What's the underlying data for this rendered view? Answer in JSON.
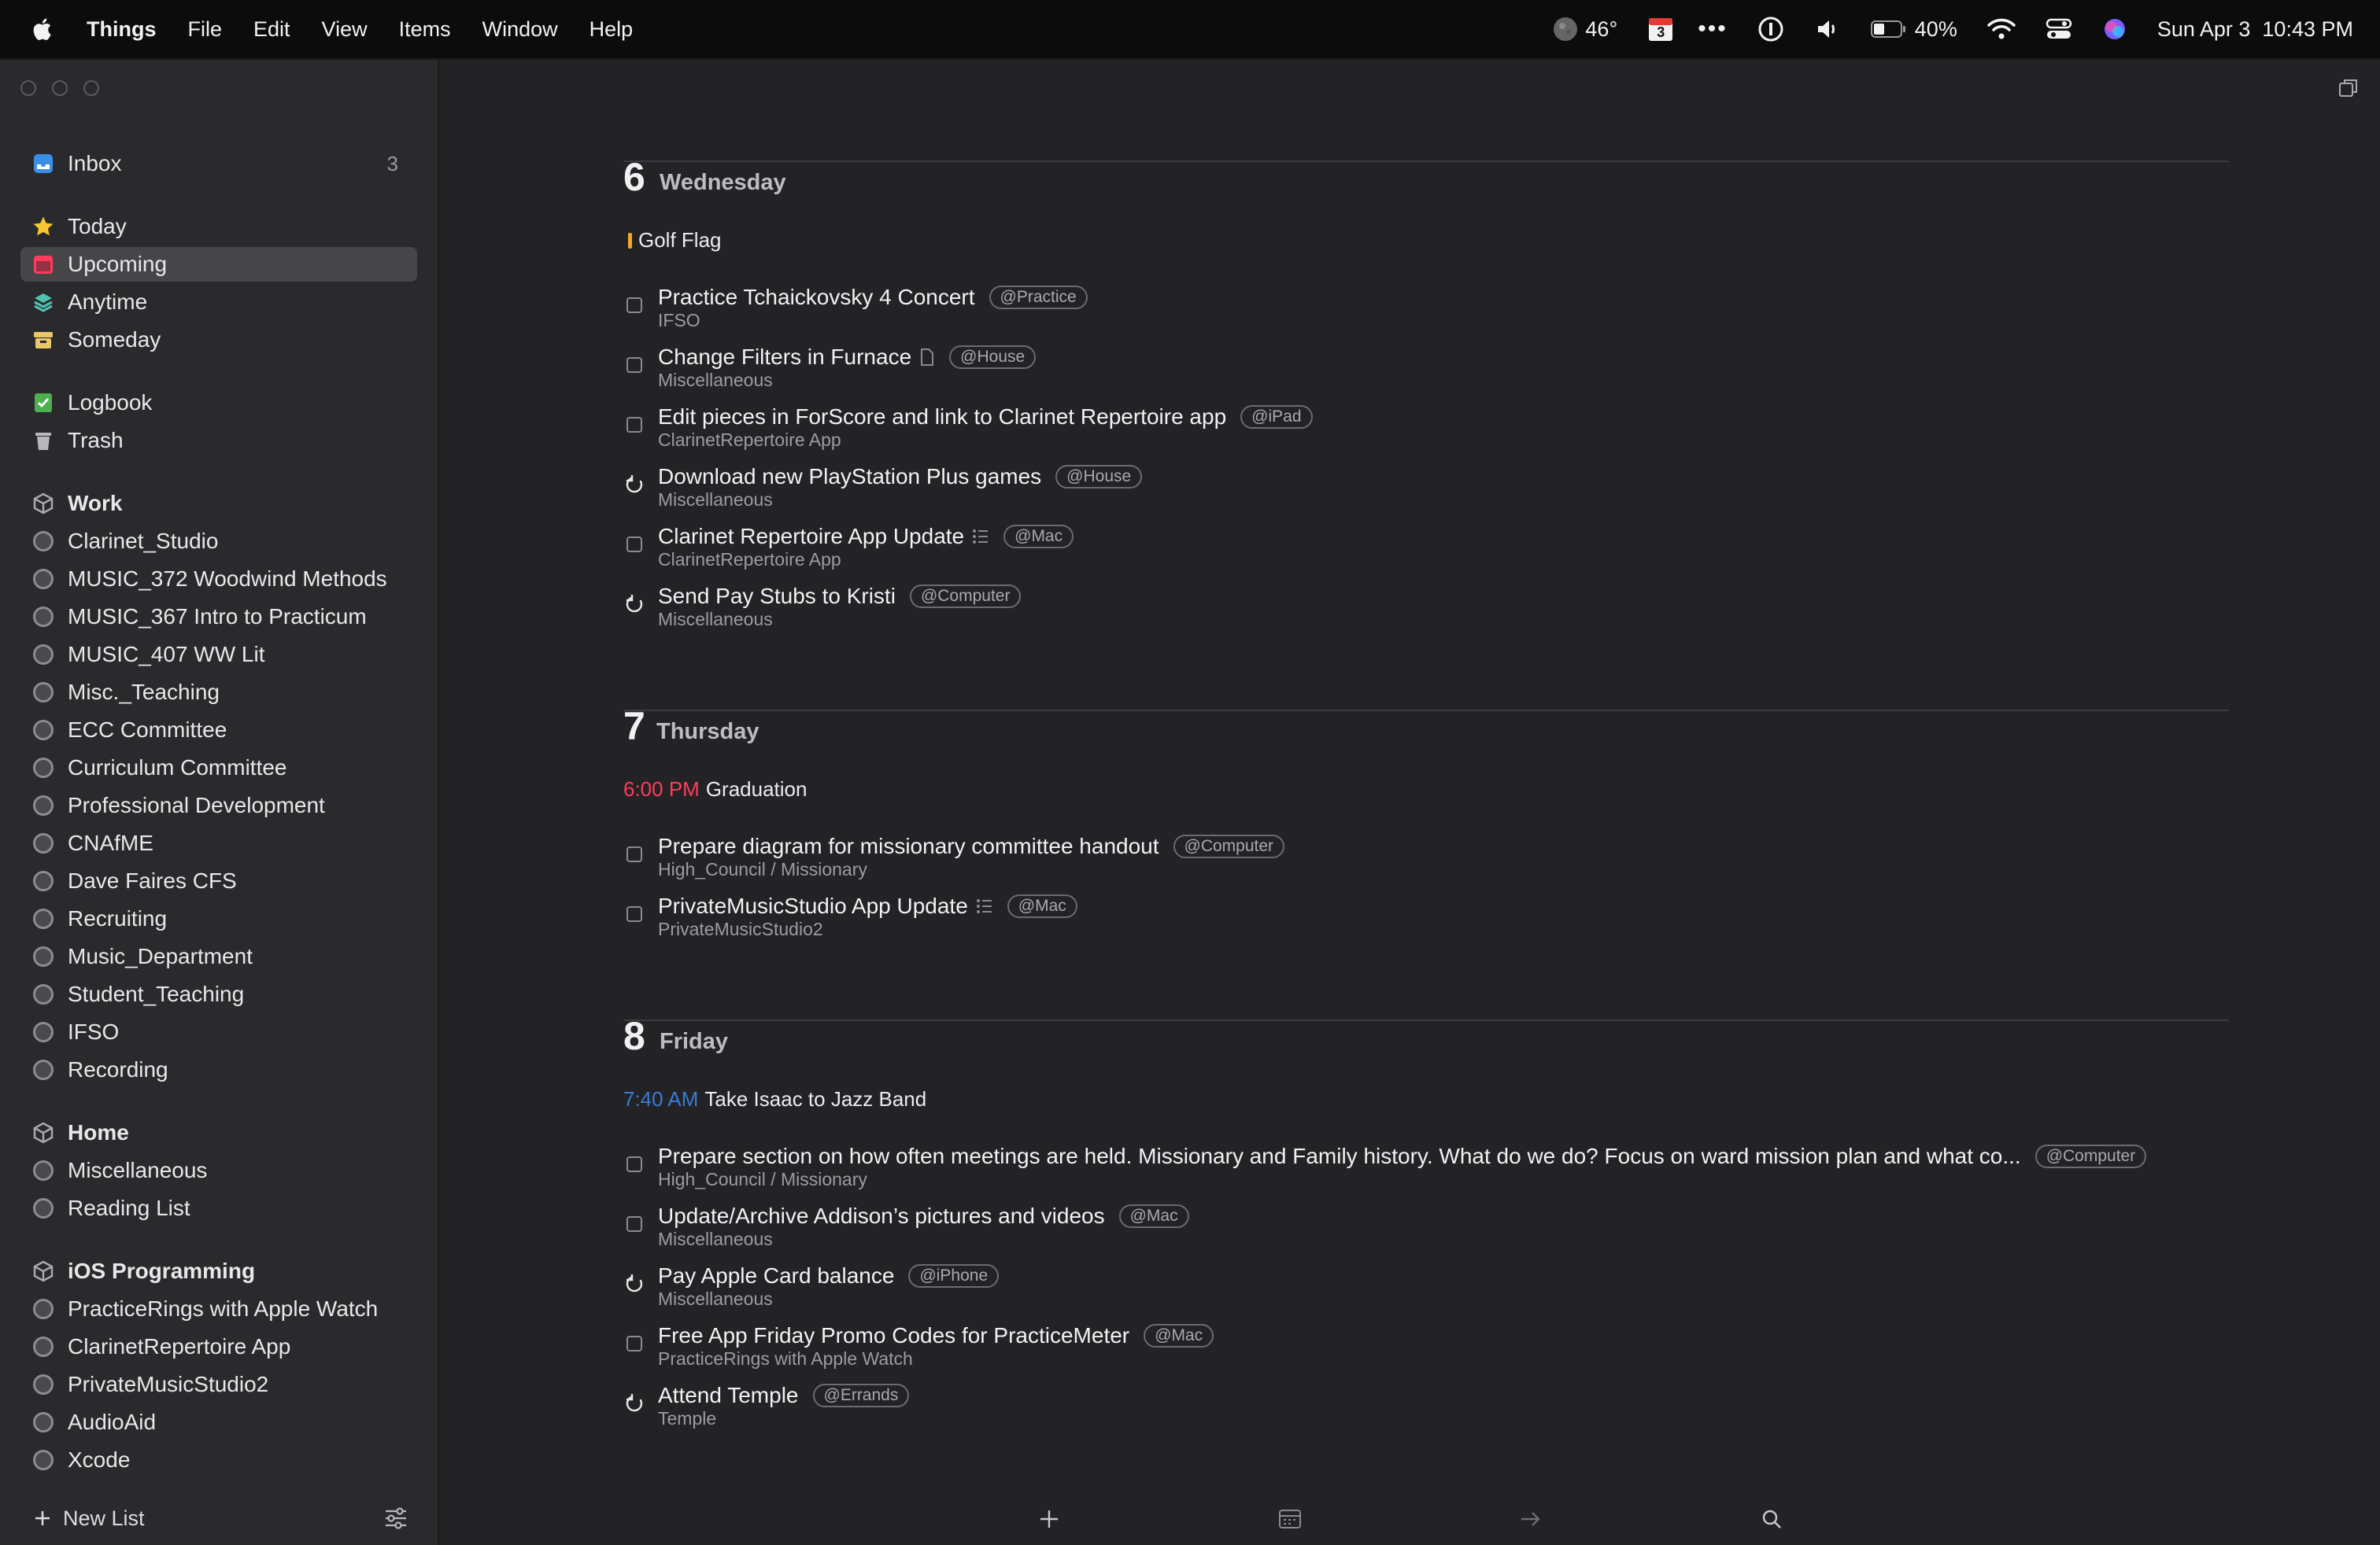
{
  "menubar": {
    "app_name": "Things",
    "menus": [
      "File",
      "Edit",
      "View",
      "Items",
      "Window",
      "Help"
    ],
    "weather": "46°",
    "calendar_day": "3",
    "battery": "40%",
    "datetime": "Sun Apr 3  10:43 PM"
  },
  "sidebar": {
    "inbox": {
      "label": "Inbox",
      "count": "3"
    },
    "today": "Today",
    "upcoming": "Upcoming",
    "anytime": "Anytime",
    "someday": "Someday",
    "logbook": "Logbook",
    "trash": "Trash",
    "areas": [
      {
        "name": "Work",
        "projects": [
          "Clarinet_Studio",
          "MUSIC_372 Woodwind Methods",
          "MUSIC_367 Intro to Practicum",
          "MUSIC_407 WW Lit",
          "Misc._Teaching",
          "ECC Committee",
          "Curriculum Committee",
          "Professional Development",
          "CNAfME",
          "Dave Faires CFS",
          "Recruiting",
          "Music_Department",
          "Student_Teaching",
          "IFSO",
          "Recording"
        ]
      },
      {
        "name": "Home",
        "projects": [
          "Miscellaneous",
          "Reading List"
        ]
      },
      {
        "name": "iOS Programming",
        "projects": [
          "PracticeRings with Apple Watch",
          "ClarinetRepertoire App",
          "PrivateMusicStudio2",
          "AudioAid",
          "Xcode"
        ]
      }
    ],
    "new_list": "New List"
  },
  "days": [
    {
      "number": "6",
      "name": "Wednesday",
      "event": {
        "time": "",
        "title": "Golf Flag"
      },
      "tasks": [
        {
          "title": "Practice Tchaickovsky 4 Concert",
          "tag": "@Practice",
          "project": "IFSO",
          "repeat": false,
          "note": false,
          "checklist": false
        },
        {
          "title": "Change Filters in Furnace",
          "tag": "@House",
          "project": "Miscellaneous",
          "repeat": false,
          "note": true,
          "checklist": false
        },
        {
          "title": "Edit pieces in ForScore and link to Clarinet Repertoire app",
          "tag": "@iPad",
          "project": "ClarinetRepertoire App",
          "repeat": false,
          "note": false,
          "checklist": false
        },
        {
          "title": "Download new PlayStation Plus games",
          "tag": "@House",
          "project": "Miscellaneous",
          "repeat": true,
          "note": false,
          "checklist": false
        },
        {
          "title": "Clarinet Repertoire App Update",
          "tag": "@Mac",
          "project": "ClarinetRepertoire App",
          "repeat": false,
          "note": false,
          "checklist": true
        },
        {
          "title": "Send Pay Stubs to Kristi",
          "tag": "@Computer",
          "project": "Miscellaneous",
          "repeat": true,
          "note": false,
          "checklist": false
        }
      ]
    },
    {
      "number": "7",
      "name": "Thursday",
      "event": {
        "time": "6:00 PM",
        "title": "Graduation",
        "time_color": "#ff3b5c"
      },
      "tasks": [
        {
          "title": "Prepare diagram for missionary committee handout",
          "tag": "@Computer",
          "project": "High_Council / Missionary",
          "repeat": false,
          "note": false,
          "checklist": false
        },
        {
          "title": "PrivateMusicStudio App Update",
          "tag": "@Mac",
          "project": "PrivateMusicStudio2",
          "repeat": false,
          "note": false,
          "checklist": true
        }
      ]
    },
    {
      "number": "8",
      "name": "Friday",
      "event": {
        "time": "7:40 AM",
        "title": "Take Isaac to Jazz Band",
        "time_color": "#3a7bd5"
      },
      "tasks": [
        {
          "title": "Prepare section on how often meetings are held. Missionary and Family history. What do we do? Focus on ward mission plan and what co...",
          "tag": "@Computer",
          "project": "High_Council / Missionary",
          "repeat": false,
          "note": false,
          "checklist": false
        },
        {
          "title": "Update/Archive Addison’s pictures and videos",
          "tag": "@Mac",
          "project": "Miscellaneous",
          "repeat": false,
          "note": false,
          "checklist": false
        },
        {
          "title": "Pay Apple Card balance",
          "tag": "@iPhone",
          "project": "Miscellaneous",
          "repeat": true,
          "note": false,
          "checklist": false
        },
        {
          "title": "Free App Friday Promo Codes for PracticeMeter",
          "tag": "@Mac",
          "project": "PracticeRings with Apple Watch",
          "repeat": false,
          "note": false,
          "checklist": false
        },
        {
          "title": "Attend Temple",
          "tag": "@Errands",
          "project": "Temple",
          "repeat": true,
          "note": false,
          "checklist": false
        }
      ]
    }
  ],
  "colors": {
    "accent_upcoming": "#ff3b5c",
    "golf_flag_bar": "#f5a623"
  }
}
